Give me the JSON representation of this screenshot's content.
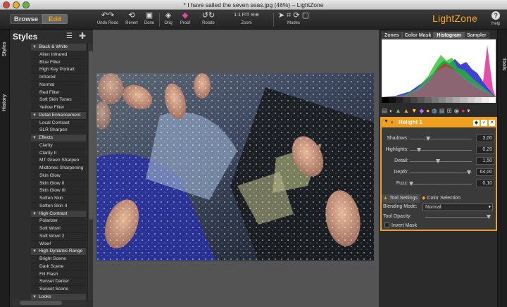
{
  "window": {
    "title": "* I have sailed the seven seas.jpg (46%) – LightZone"
  },
  "toolbar": {
    "browse": "Browse",
    "edit": "Edit",
    "undo_redo": "Undo Redo",
    "revert": "Revert",
    "done": "Done",
    "orig": "Orig",
    "proof": "Proof",
    "rotate": "Rotate",
    "zoom_1to1": "1:1",
    "zoom_fit": "FIT",
    "zoom": "Zoom",
    "modes": "Modes",
    "brand": "LightZone",
    "help": "Help"
  },
  "left_tabs": {
    "styles": "Styles",
    "history": "History"
  },
  "styles": {
    "title": "Styles",
    "items": [
      {
        "label": "Black & White",
        "category": true
      },
      {
        "label": "Alien Infrared"
      },
      {
        "label": "Blue Filter"
      },
      {
        "label": "High Key Portrait"
      },
      {
        "label": "Infrared"
      },
      {
        "label": "Normal"
      },
      {
        "label": "Red Filter"
      },
      {
        "label": "Soft Skin Tones"
      },
      {
        "label": "Yellow Filter"
      },
      {
        "label": "Detail Enhancement",
        "category": true
      },
      {
        "label": "Local Contrast"
      },
      {
        "label": "SLR Sharpen"
      },
      {
        "label": "Effects",
        "category": true
      },
      {
        "label": "Clarity"
      },
      {
        "label": "Clarity II"
      },
      {
        "label": "MT Green Sharpen"
      },
      {
        "label": "Midtones Sharpening"
      },
      {
        "label": "Skin Glow"
      },
      {
        "label": "Skin Glow II"
      },
      {
        "label": "Skin Glow III"
      },
      {
        "label": "Soften Skin"
      },
      {
        "label": "Soften Skin II"
      },
      {
        "label": "High Contrast",
        "category": true
      },
      {
        "label": "Polarizer"
      },
      {
        "label": "Soft Wow!"
      },
      {
        "label": "Soft Wow! 2"
      },
      {
        "label": "Wow!"
      },
      {
        "label": "High Dynamic Range",
        "category": true
      },
      {
        "label": "Bright Scene"
      },
      {
        "label": "Dark Scene"
      },
      {
        "label": "Fill Flash"
      },
      {
        "label": "Sunset Darker"
      },
      {
        "label": "Sunset Scene"
      },
      {
        "label": "Looks",
        "category": true
      }
    ]
  },
  "right_tabs": {
    "tabs": [
      "Zones",
      "Color Mask",
      "Histogram",
      "Sampler"
    ],
    "active": "Histogram",
    "tools_tab": "Tools"
  },
  "relight": {
    "title": "Relight 1",
    "sliders": [
      {
        "label": "Shadows:",
        "value": "3,00",
        "pos": 0.3
      },
      {
        "label": "Highlights:",
        "value": "0,20",
        "pos": 0.15
      },
      {
        "label": "Detail:",
        "value": "1,50",
        "pos": 0.45
      },
      {
        "label": "Depth:",
        "value": "64,00",
        "pos": 0.95
      },
      {
        "label": "Fuzz:",
        "value": "0,10",
        "pos": 0.02
      }
    ],
    "tool_settings": "Tool Settings",
    "color_selection": "Color Selection",
    "blending_mode_label": "Blending Mode:",
    "blending_mode": "Normal",
    "tool_opacity_label": "Tool Opacity:",
    "tool_opacity": 1.0,
    "invert_mask": "Invert Mask"
  },
  "colors": {
    "accent": "#f0a020",
    "brand": "#f6a41c"
  }
}
